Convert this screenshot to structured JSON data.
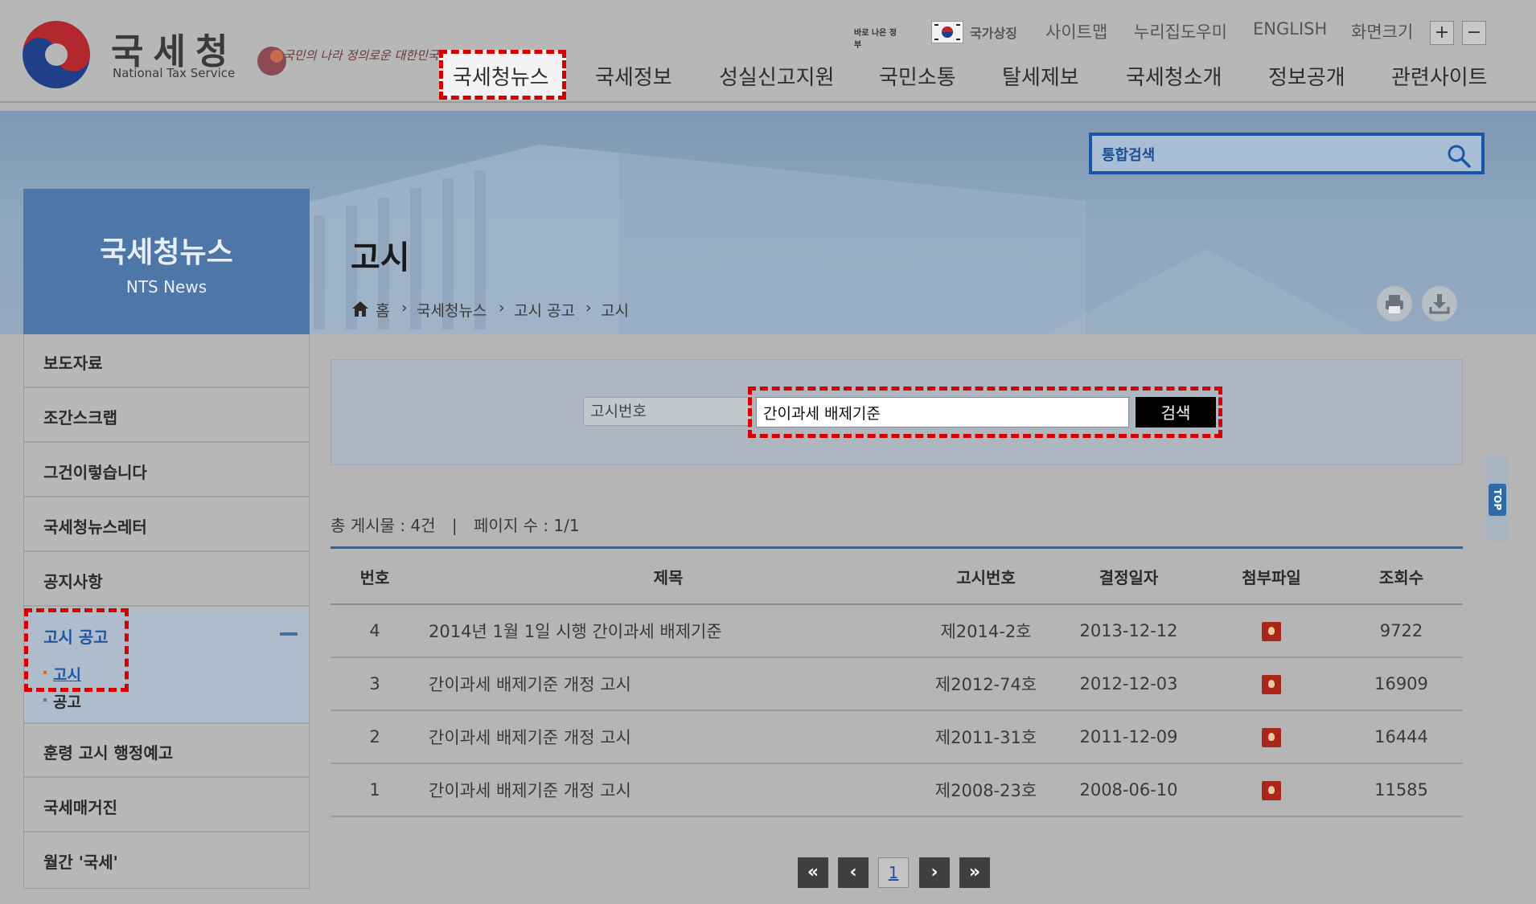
{
  "header": {
    "logo_ko": "국세청",
    "logo_en": "National Tax Service",
    "slogan": "국민의 나라 정의로운 대한민국",
    "gov_badge": "바로 나은 정부",
    "utility": [
      "국가상징",
      "사이트맵",
      "누리집도우미",
      "ENGLISH",
      "화면크기"
    ],
    "zoom_plus": "+",
    "zoom_minus": "−"
  },
  "gnb": [
    "국세청뉴스",
    "국세정보",
    "성실신고지원",
    "국민소통",
    "탈세제보",
    "국세청소개",
    "정보공개",
    "관련사이트"
  ],
  "search": {
    "placeholder": "통합검색"
  },
  "snb": {
    "title": "국세청뉴스",
    "subtitle": "NTS News"
  },
  "page": {
    "title": "고시",
    "breadcrumb": [
      "홈",
      "국세청뉴스",
      "고시 공고",
      "고시"
    ]
  },
  "lnb": {
    "items_top": [
      "보도자료",
      "조간스크랩",
      "그건이렇습니다",
      "국세청뉴스레터",
      "공지사항"
    ],
    "open_item": "고시 공고",
    "sub_items": [
      "고시",
      "공고"
    ],
    "items_bottom": [
      "훈령 고시 행정예고",
      "국세매거진",
      "월간 '국세'"
    ]
  },
  "form": {
    "select_value": "고시번호",
    "input_value": "간이과세 배제기준",
    "button": "검색"
  },
  "list": {
    "count_text": "총 게시물 : 4건",
    "separator": "|",
    "page_text": "페이지 수 : 1/1",
    "headers": [
      "번호",
      "제목",
      "고시번호",
      "결정일자",
      "첨부파일",
      "조회수"
    ],
    "rows": [
      {
        "num": "4",
        "title": "2014년 1월 1일 시행 간이과세 배제기준",
        "code": "제2014-2호",
        "date": "2013-12-12",
        "views": "9722"
      },
      {
        "num": "3",
        "title": "간이과세 배제기준 개정 고시",
        "code": "제2012-74호",
        "date": "2012-12-03",
        "views": "16909"
      },
      {
        "num": "2",
        "title": "간이과세 배제기준 개정 고시",
        "code": "제2011-31호",
        "date": "2011-12-09",
        "views": "16444"
      },
      {
        "num": "1",
        "title": "간이과세 배제기준 개정 고시",
        "code": "제2008-23호",
        "date": "2008-06-10",
        "views": "11585"
      }
    ]
  },
  "pagination": {
    "first": "«",
    "prev": "‹",
    "current": "1",
    "next": "›",
    "last": "»"
  },
  "top_button": "TOP"
}
